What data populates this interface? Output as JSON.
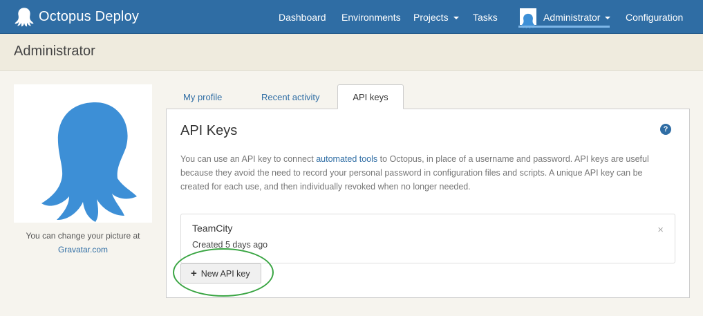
{
  "app": {
    "title": "Octopus Deploy"
  },
  "nav": {
    "items": [
      {
        "label": "Dashboard"
      },
      {
        "label": "Environments"
      },
      {
        "label": "Projects"
      },
      {
        "label": "Tasks"
      },
      {
        "label": "Administrator"
      },
      {
        "label": "Configuration"
      }
    ]
  },
  "page": {
    "title": "Administrator"
  },
  "profile": {
    "change_text": "You can change your picture at",
    "gravatar_link": "Gravatar.com"
  },
  "tabs": [
    {
      "label": "My profile",
      "active": false
    },
    {
      "label": "Recent activity",
      "active": false
    },
    {
      "label": "API keys",
      "active": true
    }
  ],
  "panel": {
    "title": "API Keys",
    "help_label": "?",
    "description_before": "You can use an API key to connect ",
    "description_link": "automated tools",
    "description_after": " to Octopus, in place of a username and password. API keys are useful because they avoid the need to record your personal password in configuration files and scripts. A unique API key can be created for each use, and then individually revoked when no longer needed."
  },
  "api_keys": [
    {
      "name": "TeamCity",
      "created": "Created 5 days ago"
    }
  ],
  "buttons": {
    "new_api_key": "New API key",
    "remove_glyph": "×"
  },
  "icons": {
    "brand": "octopus-logo-icon",
    "help": "help-circle-icon",
    "plus": "plus-icon",
    "close": "close-icon"
  },
  "colors": {
    "navbar": "#2f6da4",
    "link": "#2f6da4",
    "octopus": "#3d8fd6",
    "highlight": "#3aa543",
    "page_bg": "#f6f4ee",
    "header_bg": "#efebde"
  }
}
